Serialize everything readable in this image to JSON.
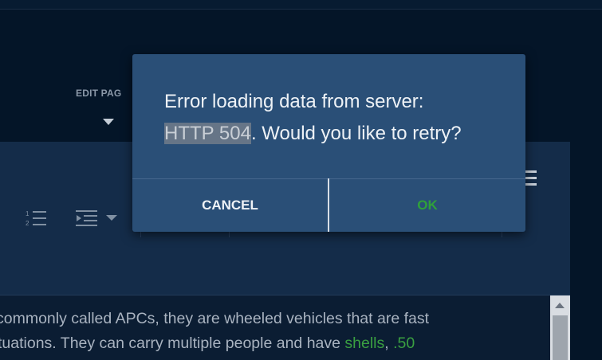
{
  "header": {
    "edit_page_label": "EDIT PAG"
  },
  "editor": {
    "line1_a": "commonly called APCs, they are wheeled vehicles that are fast",
    "line2_a": "tuations. They can carry multiple people and have ",
    "line2_link1": "shells",
    "line2_sep": ", ",
    "line2_link2": ".50"
  },
  "dialog": {
    "line1": "Error loading data from server:",
    "highlighted": "HTTP 504",
    "line2_rest": ". Would you like to retry?",
    "cancel_label": "CANCEL",
    "ok_label": "OK"
  },
  "colors": {
    "background": "#041528",
    "dialog": "#2a4f77",
    "ok": "#2fa13a",
    "link": "#3aa041"
  },
  "icons": [
    "ordered-list-icon",
    "indent-icon",
    "chevron-down-icon",
    "hamburger-menu-icon",
    "caret-down-icon",
    "scroll-up-arrow-icon"
  ]
}
